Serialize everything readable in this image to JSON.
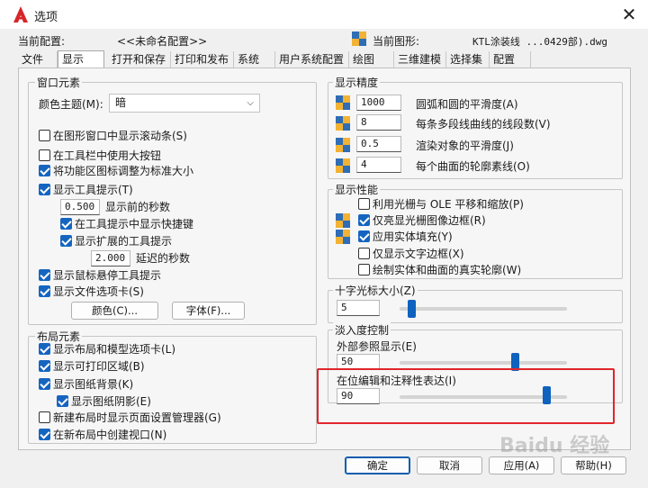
{
  "window": {
    "title": "选项",
    "close_glyph": "✕"
  },
  "profile": {
    "label": "当前配置:",
    "value": "<<未命名配置>>",
    "drawing_label": "当前图形:",
    "drawing_value": "KTL涂装线 ...0429部).dwg"
  },
  "tabs": [
    "文件",
    "显示",
    "打开和保存",
    "打印和发布",
    "系统",
    "用户系统配置",
    "绘图",
    "三维建模",
    "选择集",
    "配置"
  ],
  "active_tab": "显示",
  "window_elements": {
    "title": "窗口元素",
    "color_theme_label": "颜色主题(M):",
    "color_theme_value": "暗",
    "cb_scrollbars": "在图形窗口中显示滚动条(S)",
    "cb_large_buttons": "在工具栏中使用大按钮",
    "cb_resize_icons": "将功能区图标调整为标准大小",
    "cb_tooltips": "显示工具提示(T)",
    "tooltip_delay_value": "0.500",
    "tooltip_delay_label": "显示前的秒数",
    "cb_shortcut_keys": "在工具提示中显示快捷键",
    "cb_extended_tips": "显示扩展的工具提示",
    "extended_delay_value": "2.000",
    "extended_delay_label": "延迟的秒数",
    "cb_rollover": "显示鼠标悬停工具提示",
    "cb_file_tabs": "显示文件选项卡(S)",
    "colors_button": "颜色(C)...",
    "fonts_button": "字体(F)..."
  },
  "layout_elements": {
    "title": "布局元素",
    "cb_layout_tabs": "显示布局和模型选项卡(L)",
    "cb_printable": "显示可打印区域(B)",
    "cb_paper_bg": "显示图纸背景(K)",
    "cb_paper_shadow": "显示图纸阴影(E)",
    "cb_page_setup": "新建布局时显示页面设置管理器(G)",
    "cb_viewport": "在新布局中创建视口(N)"
  },
  "display_resolution": {
    "title": "显示精度",
    "arc_value": "1000",
    "arc_label": "圆弧和圆的平滑度(A)",
    "polyline_value": "8",
    "polyline_label": "每条多段线曲线的线段数(V)",
    "render_value": "0.5",
    "render_label": "渲染对象的平滑度(J)",
    "contour_value": "4",
    "contour_label": "每个曲面的轮廓素线(O)"
  },
  "display_performance": {
    "title": "显示性能",
    "cb_pan_zoom": "利用光栅与 OLE 平移和缩放(P)",
    "cb_raster_frame": "仅亮显光栅图像边框(R)",
    "cb_solid_fill": "应用实体填充(Y)",
    "cb_text_frame": "仅显示文字边框(X)",
    "cb_silhouettes": "绘制实体和曲面的真实轮廓(W)"
  },
  "crosshair": {
    "title": "十字光标大小(Z)",
    "value": "5",
    "slider_fraction": 0.05
  },
  "fade_control": {
    "title": "淡入度控制",
    "xref_label": "外部参照显示(E)",
    "xref_value": "50",
    "xref_fraction": 0.7,
    "inplace_label": "在位编辑和注释性表达(I)",
    "inplace_value": "90",
    "inplace_fraction": 0.9
  },
  "buttons": {
    "ok": "确定",
    "cancel": "取消",
    "apply": "应用(A)",
    "help": "帮助(H)"
  },
  "watermark": "Baidu 经验",
  "colors": {
    "accent": "#0f62be",
    "highlight": "#e0262b"
  }
}
